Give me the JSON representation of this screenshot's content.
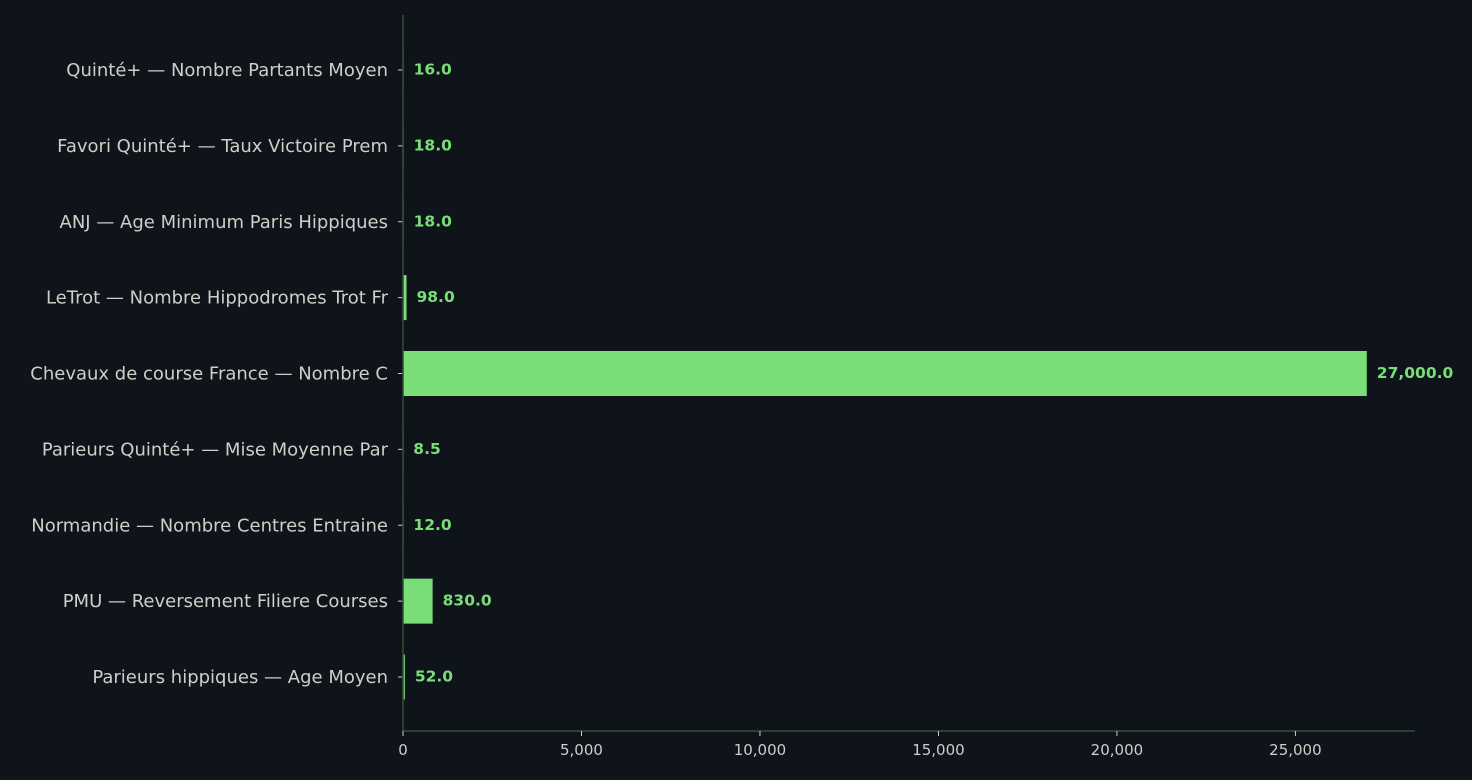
{
  "chart_data": {
    "type": "bar",
    "orientation": "horizontal",
    "categories": [
      "Quinté+ — Nombre Partants Moyen",
      "Favori Quinté+ — Taux Victoire Prem",
      "ANJ — Age Minimum Paris Hippiques",
      "LeTrot — Nombre Hippodromes Trot Fr",
      "Chevaux de course France — Nombre C",
      "Parieurs Quinté+ — Mise Moyenne Par",
      "Normandie — Nombre Centres Entraine",
      "PMU — Reversement Filiere Courses",
      "Parieurs hippiques — Age Moyen"
    ],
    "values": [
      16.0,
      18.0,
      18.0,
      98.0,
      27000.0,
      8.5,
      12.0,
      830.0,
      52.0
    ],
    "value_labels": [
      "16.0",
      "18.0",
      "18.0",
      "98.0",
      "27,000.0",
      "8.5",
      "12.0",
      "830.0",
      "52.0"
    ],
    "xlim": [
      0,
      28350
    ],
    "xticks": [
      0,
      5000,
      10000,
      15000,
      20000,
      25000
    ],
    "xtick_labels": [
      "0",
      "5,000",
      "10,000",
      "15,000",
      "20,000",
      "25,000"
    ],
    "title": "",
    "xlabel": "",
    "ylabel": "",
    "grid": false,
    "colors": {
      "bar": "#79dd78",
      "background": "#0f131a",
      "text": "#c9d1c9",
      "axis": "#3a4a3a"
    }
  }
}
